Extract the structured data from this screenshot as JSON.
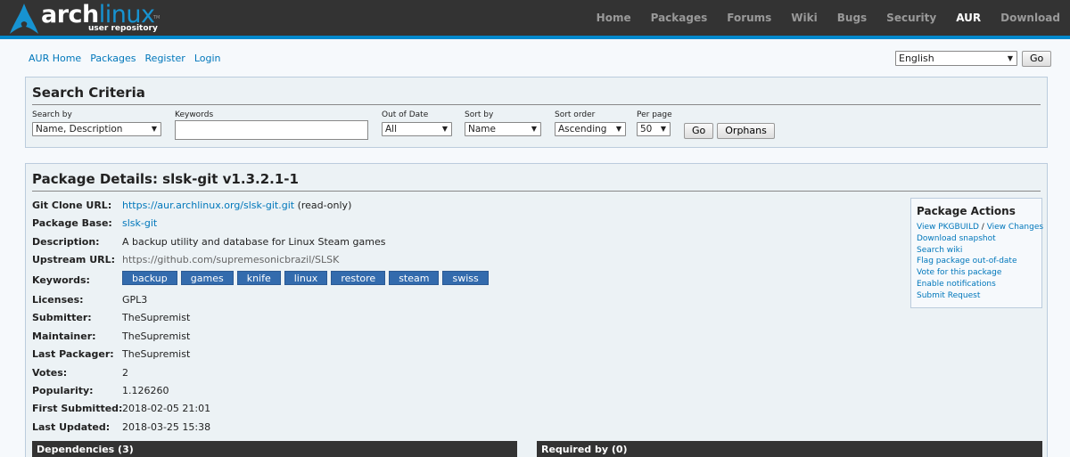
{
  "logo": {
    "word_arch": "arch",
    "word_linux": "linux",
    "tm": "TM",
    "subtitle": "user repository"
  },
  "mainnav": [
    {
      "label": "Home",
      "active": false
    },
    {
      "label": "Packages",
      "active": false
    },
    {
      "label": "Forums",
      "active": false
    },
    {
      "label": "Wiki",
      "active": false
    },
    {
      "label": "Bugs",
      "active": false
    },
    {
      "label": "Security",
      "active": false
    },
    {
      "label": "AUR",
      "active": true
    },
    {
      "label": "Download",
      "active": false
    }
  ],
  "subnav": {
    "home": "AUR Home",
    "packages": "Packages",
    "register": "Register",
    "login": "Login"
  },
  "language": {
    "selected": "English",
    "go": "Go"
  },
  "search": {
    "title": "Search Criteria",
    "search_by_label": "Search by",
    "search_by_value": "Name, Description",
    "keywords_label": "Keywords",
    "keywords_value": "",
    "out_of_date_label": "Out of Date",
    "out_of_date_value": "All",
    "sort_by_label": "Sort by",
    "sort_by_value": "Name",
    "sort_order_label": "Sort order",
    "sort_order_value": "Ascending",
    "per_page_label": "Per page",
    "per_page_value": "50",
    "go": "Go",
    "orphans": "Orphans"
  },
  "details": {
    "title": "Package Details: slsk-git v1.3.2.1-1",
    "git_clone_label": "Git Clone URL:",
    "git_clone_url": "https://aur.archlinux.org/slsk-git.git",
    "git_clone_note": "(read-only)",
    "package_base_label": "Package Base:",
    "package_base": "slsk-git",
    "description_label": "Description:",
    "description": "A backup utility and database for Linux Steam games",
    "upstream_label": "Upstream URL:",
    "upstream_url": "https://github.com/supremesonicbrazil/SLSK",
    "keywords_label": "Keywords:",
    "keywords": [
      "backup",
      "games",
      "knife",
      "linux",
      "restore",
      "steam",
      "swiss"
    ],
    "licenses_label": "Licenses:",
    "licenses": "GPL3",
    "submitter_label": "Submitter:",
    "submitter": "TheSupremist",
    "maintainer_label": "Maintainer:",
    "maintainer": "TheSupremist",
    "last_packager_label": "Last Packager:",
    "last_packager": "TheSupremist",
    "votes_label": "Votes:",
    "votes": "2",
    "popularity_label": "Popularity:",
    "popularity": "1.126260",
    "first_submitted_label": "First Submitted:",
    "first_submitted": "2018-02-05 21:01",
    "last_updated_label": "Last Updated:",
    "last_updated": "2018-03-25 15:38"
  },
  "actions": {
    "title": "Package Actions",
    "view_pkgbuild": "View PKGBUILD",
    "separator": "/",
    "view_changes": "View Changes",
    "download_snapshot": "Download snapshot",
    "search_wiki": "Search wiki",
    "flag_out_of_date": "Flag package out-of-date",
    "vote": "Vote for this package",
    "notifications": "Enable notifications",
    "submit_request": "Submit Request"
  },
  "dependencies_header": "Dependencies (3)",
  "required_by_header": "Required by (0)"
}
